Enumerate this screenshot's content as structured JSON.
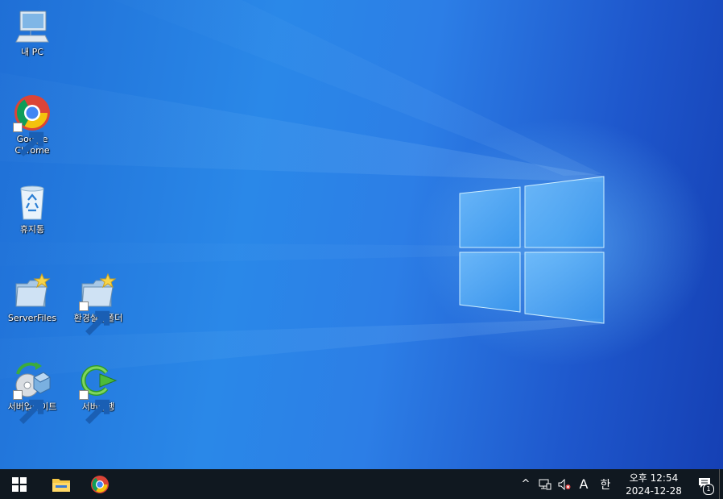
{
  "desktop": {
    "icons": [
      {
        "id": "this-pc",
        "label": "내 PC",
        "icon": "monitor-icon",
        "shortcut": false
      },
      {
        "id": "google-chrome",
        "label": "Google Chrome",
        "icon": "chrome-icon",
        "shortcut": true
      },
      {
        "id": "recycle-bin",
        "label": "휴지통",
        "icon": "recycle-bin-icon",
        "shortcut": false
      },
      {
        "id": "server-files",
        "label": "ServerFiles",
        "icon": "folder-star-icon",
        "shortcut": false
      },
      {
        "id": "env-settings-folder",
        "label": "환경설정폴더",
        "icon": "folder-star-icon",
        "shortcut": true
      },
      {
        "id": "server-update",
        "label": "서버업데이트",
        "icon": "disc-update-icon",
        "shortcut": true
      },
      {
        "id": "server-run",
        "label": "서버실행",
        "icon": "green-arrow-icon",
        "shortcut": true
      }
    ]
  },
  "taskbar": {
    "start_icon": "windows-logo-icon",
    "pinned": [
      {
        "id": "file-explorer",
        "icon": "folder-icon"
      },
      {
        "id": "chrome",
        "icon": "chrome-icon"
      }
    ],
    "tray": {
      "chevron": "^",
      "ime_mode": "A",
      "ime_lang": "한",
      "time": "오후 12:54",
      "date": "2024-12-28",
      "notification_count": "1"
    }
  },
  "colors": {
    "taskbar": "#101820",
    "wallpaper_accent": "#2a88e8"
  }
}
